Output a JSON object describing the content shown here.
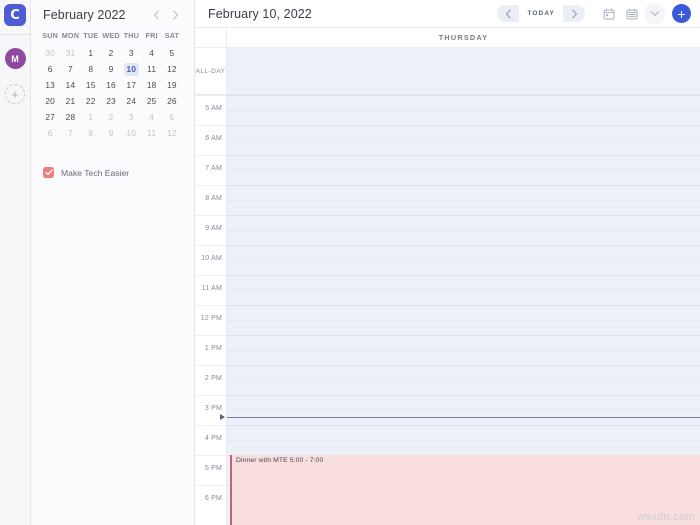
{
  "rail": {
    "logo_letter": "C",
    "avatar_letter": "M",
    "add_account_label": "+"
  },
  "sidebar": {
    "mini_calendar": {
      "title": "February 2022",
      "prev_label": "‹",
      "next_label": "›",
      "day_headers": [
        "SUN",
        "MON",
        "TUE",
        "WED",
        "THU",
        "FRI",
        "SAT"
      ],
      "weeks": [
        [
          {
            "d": "30",
            "muted": true
          },
          {
            "d": "31",
            "muted": true
          },
          {
            "d": "1"
          },
          {
            "d": "2"
          },
          {
            "d": "3"
          },
          {
            "d": "4"
          },
          {
            "d": "5"
          }
        ],
        [
          {
            "d": "6"
          },
          {
            "d": "7"
          },
          {
            "d": "8"
          },
          {
            "d": "9"
          },
          {
            "d": "10",
            "selected": true
          },
          {
            "d": "11"
          },
          {
            "d": "12"
          }
        ],
        [
          {
            "d": "13"
          },
          {
            "d": "14"
          },
          {
            "d": "15"
          },
          {
            "d": "16"
          },
          {
            "d": "17"
          },
          {
            "d": "18"
          },
          {
            "d": "19"
          }
        ],
        [
          {
            "d": "20"
          },
          {
            "d": "21"
          },
          {
            "d": "22"
          },
          {
            "d": "23"
          },
          {
            "d": "24"
          },
          {
            "d": "25"
          },
          {
            "d": "26"
          }
        ],
        [
          {
            "d": "27"
          },
          {
            "d": "28"
          },
          {
            "d": "1",
            "muted": true
          },
          {
            "d": "2",
            "muted": true
          },
          {
            "d": "3",
            "muted": true
          },
          {
            "d": "4",
            "muted": true
          },
          {
            "d": "5",
            "muted": true
          }
        ],
        [
          {
            "d": "6",
            "muted": true
          },
          {
            "d": "7",
            "muted": true
          },
          {
            "d": "8",
            "muted": true
          },
          {
            "d": "9",
            "muted": true
          },
          {
            "d": "10",
            "muted": true
          },
          {
            "d": "11",
            "muted": true
          },
          {
            "d": "12",
            "muted": true
          }
        ]
      ]
    },
    "calendars": [
      {
        "name": "Make Tech Easier",
        "color": "#f08080",
        "checked": true
      }
    ]
  },
  "toolbar": {
    "date_title": "February 10, 2022",
    "prev_label": "‹",
    "today_label": "TODAY",
    "next_label": "›",
    "icons": [
      "calendar-day-icon",
      "calendar-list-icon",
      "chevron-down-icon"
    ],
    "add_label": "+"
  },
  "calendar_view": {
    "day_header": "THURSDAY",
    "all_day_label": "ALL-DAY",
    "hours": [
      {
        "label": "5 AM"
      },
      {
        "label": "6 AM"
      },
      {
        "label": "7 AM"
      },
      {
        "label": "8 AM"
      },
      {
        "label": "9 AM"
      },
      {
        "label": "10 AM"
      },
      {
        "label": "11 AM"
      },
      {
        "label": "12 PM"
      },
      {
        "label": "1 PM"
      },
      {
        "label": "2 PM"
      },
      {
        "label": "3 PM"
      },
      {
        "label": "4 PM"
      },
      {
        "label": "5 PM"
      },
      {
        "label": "6 PM"
      }
    ],
    "events": [
      {
        "title": "Dinner with MTE",
        "time": "5:00 - 7:00",
        "start_hour_index": 12,
        "bg": "#f9dede",
        "border": "#c0647a"
      }
    ],
    "now_indicator_hour_index": 11
  },
  "annotation": {
    "arrow_color": "#e63312"
  },
  "watermark": "wsxdn.com"
}
